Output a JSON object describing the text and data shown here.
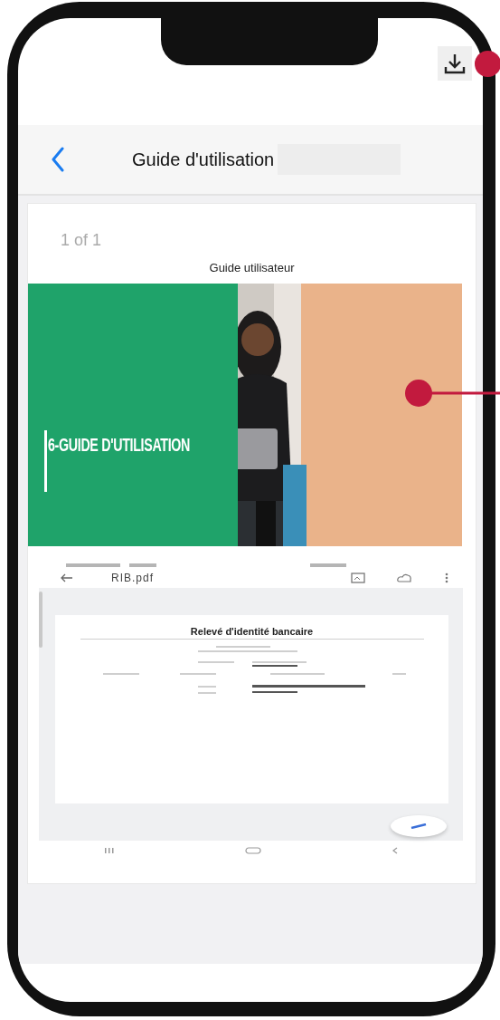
{
  "header": {
    "title": "Guide d'utilisation"
  },
  "viewer": {
    "page_counter": "1 of 1",
    "document_title": "Guide utilisateur",
    "banner": {
      "title": "6-GUIDE D'UTILISATION"
    },
    "embedded_screenshot": {
      "file_name": "RIB.pdf",
      "document_heading": "Relevé d'identité bancaire"
    }
  }
}
